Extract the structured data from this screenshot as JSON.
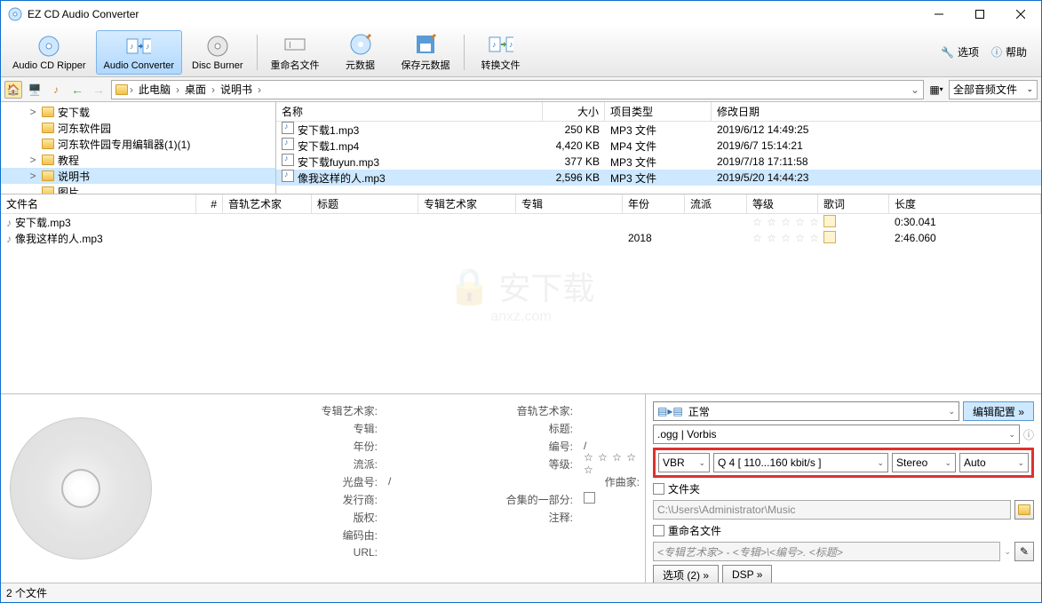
{
  "window": {
    "title": "EZ CD Audio Converter"
  },
  "toolbar": {
    "ripper": "Audio CD Ripper",
    "converter": "Audio Converter",
    "burner": "Disc Burner",
    "rename": "重命名文件",
    "metadata": "元数据",
    "savemeta": "保存元数据",
    "convert": "转换文件",
    "options": "选项",
    "help": "帮助"
  },
  "breadcrumb": [
    "此电脑",
    "桌面",
    "说明书"
  ],
  "filter": "全部音频文件",
  "tree": [
    {
      "exp": ">",
      "label": "安下载"
    },
    {
      "exp": "",
      "label": "河东软件园"
    },
    {
      "exp": "",
      "label": "河东软件园专用编辑器(1)(1)"
    },
    {
      "exp": ">",
      "label": "教程"
    },
    {
      "exp": ">",
      "label": "说明书",
      "sel": true
    },
    {
      "exp": "",
      "label": "图片"
    }
  ],
  "fileCols": {
    "name": "名称",
    "size": "大小",
    "type": "项目类型",
    "date": "修改日期"
  },
  "files": [
    {
      "name": "安下载1.mp3",
      "size": "250 KB",
      "type": "MP3 文件",
      "date": "2019/6/12 14:49:25"
    },
    {
      "name": "安下载1.mp4",
      "size": "4,420 KB",
      "type": "MP4 文件",
      "date": "2019/6/7 15:14:21"
    },
    {
      "name": "安下载fuyun.mp3",
      "size": "377 KB",
      "type": "MP3 文件",
      "date": "2019/7/18 17:11:58"
    },
    {
      "name": "像我这样的人.mp3",
      "size": "2,596 KB",
      "type": "MP3 文件",
      "date": "2019/5/20 14:44:23",
      "sel": true
    }
  ],
  "listCols": {
    "file": "文件名",
    "num": "#",
    "artist": "音轨艺术家",
    "title": "标题",
    "albumartist": "专辑艺术家",
    "album": "专辑",
    "year": "年份",
    "genre": "流派",
    "rating": "等级",
    "lyrics": "歌词",
    "length": "长度"
  },
  "list": [
    {
      "file": "安下载.mp3",
      "year": "",
      "length": "0:30.041"
    },
    {
      "file": "像我这样的人.mp3",
      "year": "2018",
      "length": "2:46.060"
    }
  ],
  "watermark": {
    "main": "安下载",
    "sub": "anxz.com"
  },
  "meta": {
    "albumartist_l": "专辑艺术家:",
    "trackartist_l": "音轨艺术家:",
    "album_l": "专辑:",
    "title_l": "标题:",
    "year_l": "年份:",
    "number_l": "编号:",
    "number_v": "/",
    "genre_l": "流派:",
    "rating_l": "等级:",
    "discid_l": "光盘号:",
    "discid_v": "/",
    "composer_l": "作曲家:",
    "publisher_l": "发行商:",
    "compilation_l": "合集的一部分:",
    "copyright_l": "版权:",
    "comment_l": "注释:",
    "encodedby_l": "编码由:",
    "url_l": "URL:"
  },
  "output": {
    "mode": "正常",
    "editconfig": "编辑配置 »",
    "format": ".ogg | Vorbis",
    "vbr": "VBR",
    "quality": "Q 4  [ 110...160 kbit/s ]",
    "channels": "Stereo",
    "auto": "Auto",
    "folder_l": "文件夹",
    "folder_path": "C:\\Users\\Administrator\\Music",
    "rename_l": "重命名文件",
    "rename_pattern": "<专辑艺术家> - <专辑>\\<编号>. <标题>",
    "options_btn": "选项 (2) »",
    "dsp_btn": "DSP »"
  },
  "status": "2 个文件"
}
